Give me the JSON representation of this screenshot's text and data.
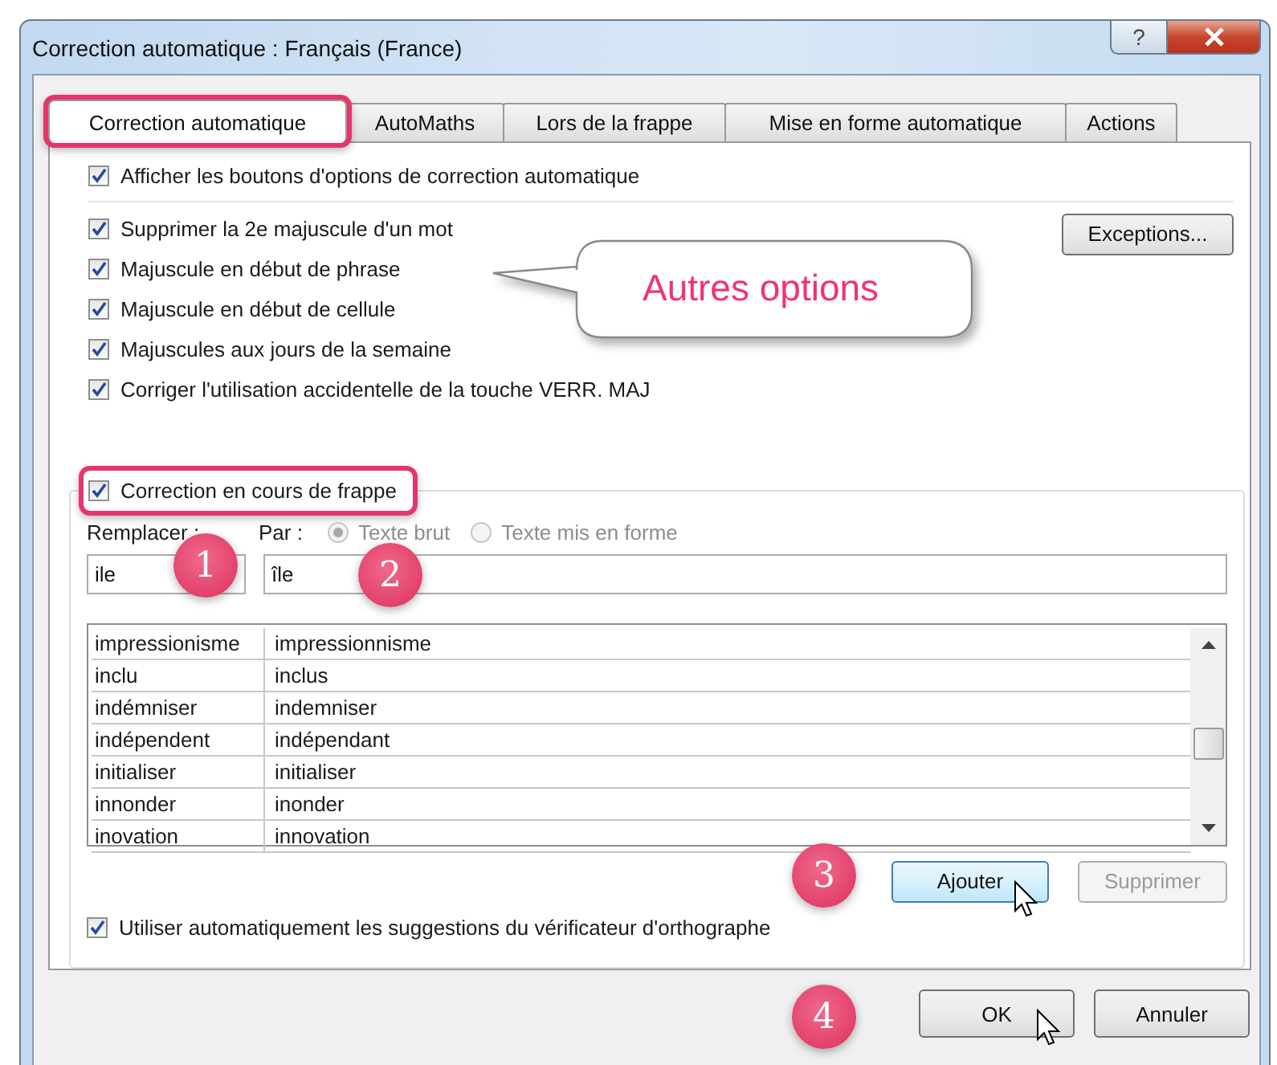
{
  "window": {
    "title": "Correction automatique : Français (France)",
    "help_button": "?"
  },
  "tabs": [
    {
      "label": "Correction automatique",
      "selected": true,
      "highlighted": true
    },
    {
      "label": "AutoMaths",
      "selected": false,
      "highlighted": false
    },
    {
      "label": "Lors de la frappe",
      "selected": false,
      "highlighted": false
    },
    {
      "label": "Mise en forme automatique",
      "selected": false,
      "highlighted": false
    },
    {
      "label": "Actions",
      "selected": false,
      "highlighted": false
    }
  ],
  "show_buttons_option": {
    "label": "Afficher les boutons d'options de correction automatique",
    "checked": true
  },
  "options": [
    {
      "label": "Supprimer la 2e majuscule d'un mot",
      "checked": true
    },
    {
      "label": "Majuscule en début de phrase",
      "checked": true
    },
    {
      "label": "Majuscule en début de cellule",
      "checked": true
    },
    {
      "label": "Majuscules aux jours de la semaine",
      "checked": true
    },
    {
      "label": "Corriger l'utilisation accidentelle de la touche VERR. MAJ",
      "checked": true
    }
  ],
  "exceptions_button": "Exceptions...",
  "typing_correction": {
    "label": "Correction en cours de frappe",
    "checked": true,
    "highlighted": true
  },
  "replace_label": "Remplacer :",
  "with_label": "Par :",
  "format_radios": [
    {
      "label": "Texte brut",
      "selected": true,
      "disabled": true
    },
    {
      "label": "Texte mis en forme",
      "selected": false,
      "disabled": true
    }
  ],
  "replace_value": "ile",
  "with_value": "île",
  "list_rows": [
    {
      "from": "impressionisme",
      "to": "impressionnisme"
    },
    {
      "from": "inclu",
      "to": "inclus"
    },
    {
      "from": "indémniser",
      "to": "indemniser"
    },
    {
      "from": "indépendent",
      "to": "indépendant"
    },
    {
      "from": "initialiser",
      "to": "initialiser"
    },
    {
      "from": "innonder",
      "to": "inonder"
    },
    {
      "from": "inovation",
      "to": "innovation"
    }
  ],
  "add_button": {
    "label": "Ajouter",
    "disabled": false
  },
  "delete_button": {
    "label": "Supprimer",
    "disabled": true
  },
  "spellcheck_option": {
    "label": "Utiliser automatiquement les suggestions du vérificateur d'orthographe",
    "checked": true
  },
  "ok_button": "OK",
  "cancel_button": "Annuler",
  "annotations": {
    "callout": "Autres options",
    "badges": [
      "1",
      "2",
      "3",
      "4"
    ]
  }
}
